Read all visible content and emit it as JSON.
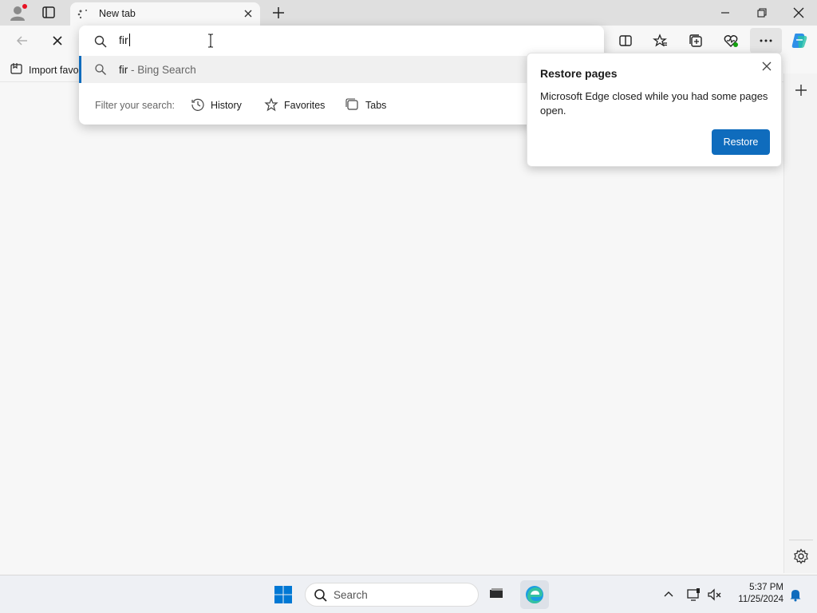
{
  "tab": {
    "title": "New tab"
  },
  "favorites_bar": {
    "import_label": "Import favo"
  },
  "omnibox": {
    "query": "fir",
    "suggestion": {
      "query": "fir",
      "separator": " - ",
      "engine": "Bing Search"
    },
    "filter": {
      "label": "Filter your search:",
      "chips": [
        "History",
        "Favorites",
        "Tabs"
      ]
    }
  },
  "restore_popup": {
    "title": "Restore pages",
    "message": "Microsoft Edge closed while you had some pages open.",
    "button": "Restore"
  },
  "taskbar": {
    "search_placeholder": "Search",
    "time": "5:37 PM",
    "date": "11/25/2024"
  },
  "colors": {
    "accent": "#0f6cbd",
    "profile_badge": "#e81123"
  }
}
